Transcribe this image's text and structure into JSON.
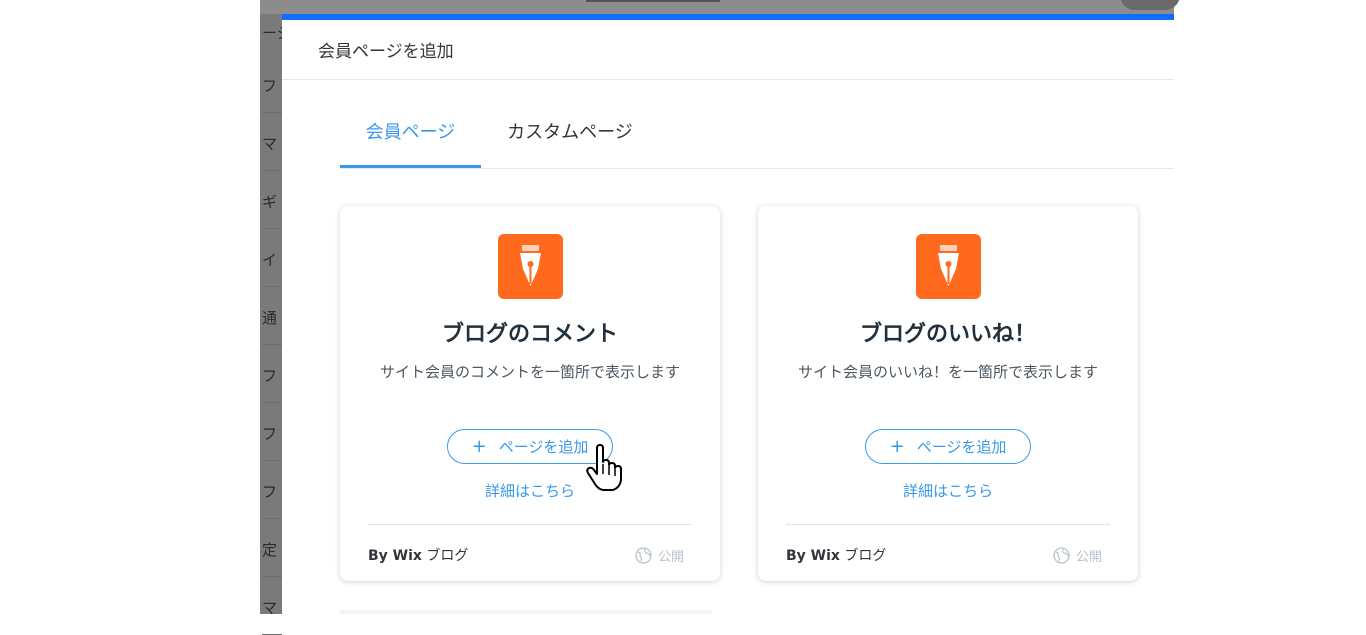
{
  "background": {
    "rows": [
      "フ",
      "マ",
      "ギ",
      "イ",
      "通",
      "フ",
      "フ",
      "フ",
      "定",
      "マ"
    ],
    "top_item": "ージ"
  },
  "modal": {
    "title": "会員ページを追加",
    "accent_color": "#116dff",
    "tabs": [
      {
        "label": "会員ページ",
        "active": true
      },
      {
        "label": "カスタムページ",
        "active": false
      }
    ]
  },
  "cards": [
    {
      "icon": "pen-nib-icon",
      "icon_color": "#ff6a1f",
      "title": "ブログのコメント",
      "description": "サイト会員のコメントを一箇所で表示します",
      "add_button": "ページを追加",
      "more_link": "詳細はこちら",
      "by_prefix": "By Wix",
      "by_name": "ブログ",
      "status": "公開"
    },
    {
      "icon": "pen-nib-icon",
      "icon_color": "#ff6a1f",
      "title": "ブログのいいね！",
      "description": "サイト会員のいいね！を一箇所で表示します",
      "add_button": "ページを追加",
      "more_link": "詳細はこちら",
      "by_prefix": "By Wix",
      "by_name": "ブログ",
      "status": "公開"
    }
  ]
}
